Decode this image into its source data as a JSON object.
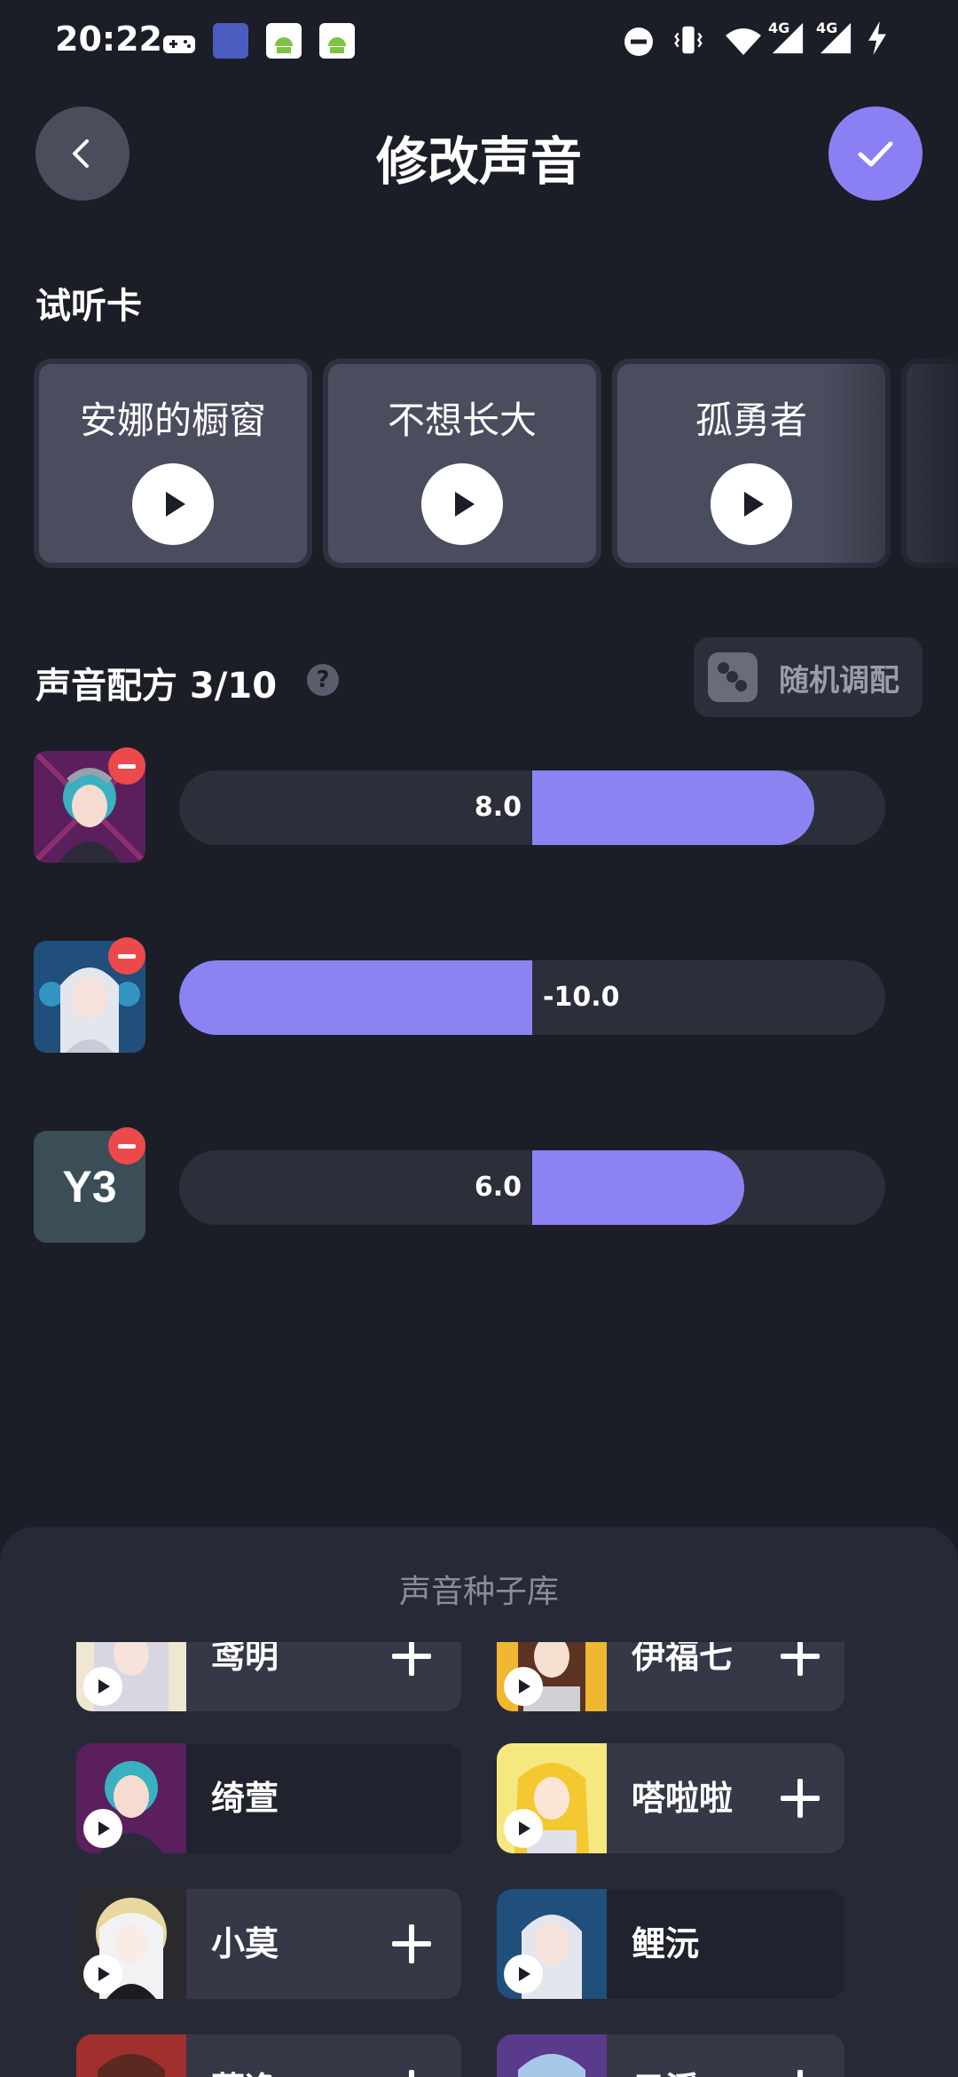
{
  "status_bar": {
    "time": "20:22",
    "network_1": "4G",
    "network_2": "4G"
  },
  "header": {
    "title": "修改声音",
    "back_icon": "chevron-left-icon",
    "confirm_icon": "check-icon"
  },
  "preview_section": {
    "label": "试听卡",
    "cards": [
      {
        "title": "安娜的橱窗"
      },
      {
        "title": "不想长大"
      },
      {
        "title": "孤勇者"
      }
    ]
  },
  "recipe": {
    "title": "声音配方 3/10",
    "help_icon": "?",
    "random_button": "随机调配",
    "slider_min": -10,
    "slider_max": 10,
    "sliders": [
      {
        "value": 8.0,
        "label": "8.0",
        "avatar": "teal-hair-girl"
      },
      {
        "value": -10.0,
        "label": "-10.0",
        "avatar": "silver-hair-girl"
      },
      {
        "value": 6.0,
        "label": "6.0",
        "avatar": "Y3"
      }
    ]
  },
  "library": {
    "title": "声音种子库",
    "items": [
      {
        "name": "鸢明",
        "added": false
      },
      {
        "name": "伊福七",
        "added": false
      },
      {
        "name": "绮萱",
        "added": true
      },
      {
        "name": "嗒啦啦",
        "added": false
      },
      {
        "name": "小莫",
        "added": false
      },
      {
        "name": "鲤沅",
        "added": true
      },
      {
        "name": "慕逸",
        "added": false
      },
      {
        "name": "云溪",
        "added": false
      }
    ]
  },
  "colors": {
    "background": "#1b1e27",
    "accent": "#8c83f2",
    "remove": "#ec4a4a"
  }
}
